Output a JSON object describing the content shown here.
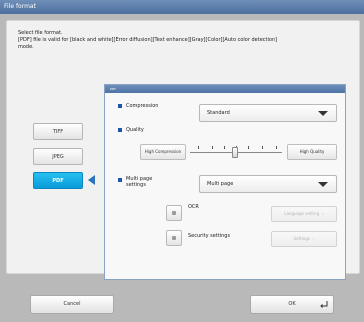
{
  "window": {
    "title": "File format"
  },
  "instruction": {
    "line1": "Select file format.",
    "line2": "[PDF] file is valid for [black and white][Error diffusion][Text enhance][Gray][Color][Auto color detection]",
    "line3": "mode."
  },
  "formats": [
    {
      "label": "TIFF",
      "selected": false
    },
    {
      "label": "JPEG",
      "selected": false
    },
    {
      "label": "PDF",
      "selected": true
    }
  ],
  "settings": {
    "header": "PDF",
    "compression": {
      "label": "Compression",
      "value": "Standard"
    },
    "quality": {
      "label": "Quality",
      "low_label": "High Compression",
      "high_label": "High Quality",
      "level": 0.5
    },
    "multipage": {
      "label_line1": "Multi page",
      "label_line2": "settings",
      "value": "Multi page"
    },
    "ocr": {
      "label": "OCR",
      "checked": false,
      "button_label": "Language setting"
    },
    "security": {
      "label": "Security settings",
      "checked": false,
      "button_label": "Settings"
    }
  },
  "footer": {
    "cancel_label": "Cancel",
    "ok_label": "OK"
  },
  "colors": {
    "accent": "#0a9ad9",
    "header": "#4f73a5",
    "bullet": "#2056a8"
  }
}
